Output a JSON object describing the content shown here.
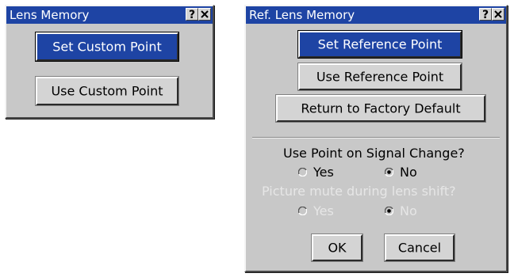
{
  "lens_memory": {
    "title": "Lens Memory",
    "help_label": "?",
    "set_custom_point": "Set Custom Point",
    "use_custom_point": "Use Custom Point"
  },
  "ref_lens_memory": {
    "title": "Ref. Lens Memory",
    "help_label": "?",
    "set_reference_point": "Set Reference Point",
    "use_reference_point": "Use Reference Point",
    "return_to_factory_default": "Return to Factory Default",
    "signal_change_question": "Use Point on Signal Change?",
    "signal_yes": "Yes",
    "signal_no": "No",
    "picture_mute_question": "Picture mute during lens shift?",
    "mute_yes": "Yes",
    "mute_no": "No",
    "ok": "OK",
    "cancel": "Cancel"
  },
  "colors": {
    "titlebar": "#1e44a4",
    "window_bg": "#c8c8c8",
    "disabled_text": "#e6e6e6"
  },
  "icons": [
    "help-icon",
    "close-icon",
    "radio-icon"
  ]
}
